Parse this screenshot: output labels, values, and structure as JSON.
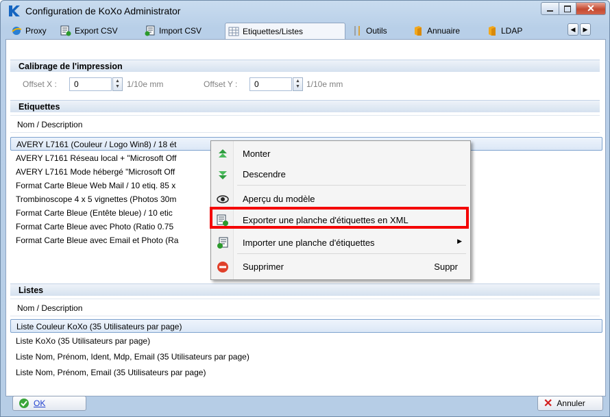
{
  "window": {
    "title": "Configuration de KoXo Administrator"
  },
  "tabs": [
    {
      "label": "Proxy",
      "icon": "proxy-globe-icon"
    },
    {
      "label": "Export CSV",
      "icon": "export-csv-icon"
    },
    {
      "label": "Import CSV",
      "icon": "import-csv-icon"
    },
    {
      "label": "Etiquettes/Listes",
      "icon": "grid-icon"
    },
    {
      "label": "Outils",
      "icon": "tools-icon"
    },
    {
      "label": "Annuaire",
      "icon": "book-icon"
    },
    {
      "label": "LDAP",
      "icon": "book-icon"
    }
  ],
  "calibrage": {
    "title": "Calibrage de l'impression",
    "offset_x_label": "Offset X :",
    "offset_x_value": "0",
    "offset_y_label": "Offset Y :",
    "offset_y_value": "0",
    "unit": "1/10e mm"
  },
  "etiquettes": {
    "title": "Etiquettes",
    "column_header": "Nom / Description",
    "rows": [
      "AVERY L7161 (Couleur / Logo Win8) / 18 ét",
      "AVERY L7161 Réseau local + \"Microsoft Off",
      "AVERY L7161 Mode hébergé \"Microsoft Off",
      "Format Carte Bleue Web Mail / 10 etiq. 85 x",
      "Trombinoscope 4 x 5 vignettes (Photos 30m",
      "Format Carte Bleue (Entête bleue) / 10 etic",
      "Format Carte Bleue avec Photo (Ratio 0.75",
      "Format Carte Bleue avec Email et Photo (Ra"
    ],
    "selected_index": 0
  },
  "listes": {
    "title": "Listes",
    "column_header": "Nom / Description",
    "rows": [
      "Liste Couleur KoXo (35 Utilisateurs par page)",
      "Liste KoXo (35 Utilisateurs par page)",
      "Liste Nom, Prénom, Ident, Mdp, Email (35 Utilisateurs par page)",
      "Liste Nom, Prénom, Email (35 Utilisateurs par page)"
    ],
    "selected_index": 0
  },
  "context_menu": {
    "items": [
      {
        "label": "Monter",
        "icon": "move-up-icon"
      },
      {
        "label": "Descendre",
        "icon": "move-down-icon"
      },
      {
        "label": "Aperçu du modèle",
        "icon": "preview-eye-icon"
      },
      {
        "label": "Exporter une planche d'étiquettes en XML",
        "icon": "export-xml-icon"
      },
      {
        "label": "Importer une planche d'étiquettes",
        "icon": "import-icon",
        "submenu": "▶"
      },
      {
        "label": "Supprimer",
        "icon": "delete-icon",
        "shortcut": "Suppr"
      }
    ]
  },
  "buttons": {
    "ok": "OK",
    "cancel": "Annuler"
  },
  "colors": {
    "highlight": "#f40000",
    "accent": "#1f6fd1",
    "selection_border": "#7da2ce"
  }
}
